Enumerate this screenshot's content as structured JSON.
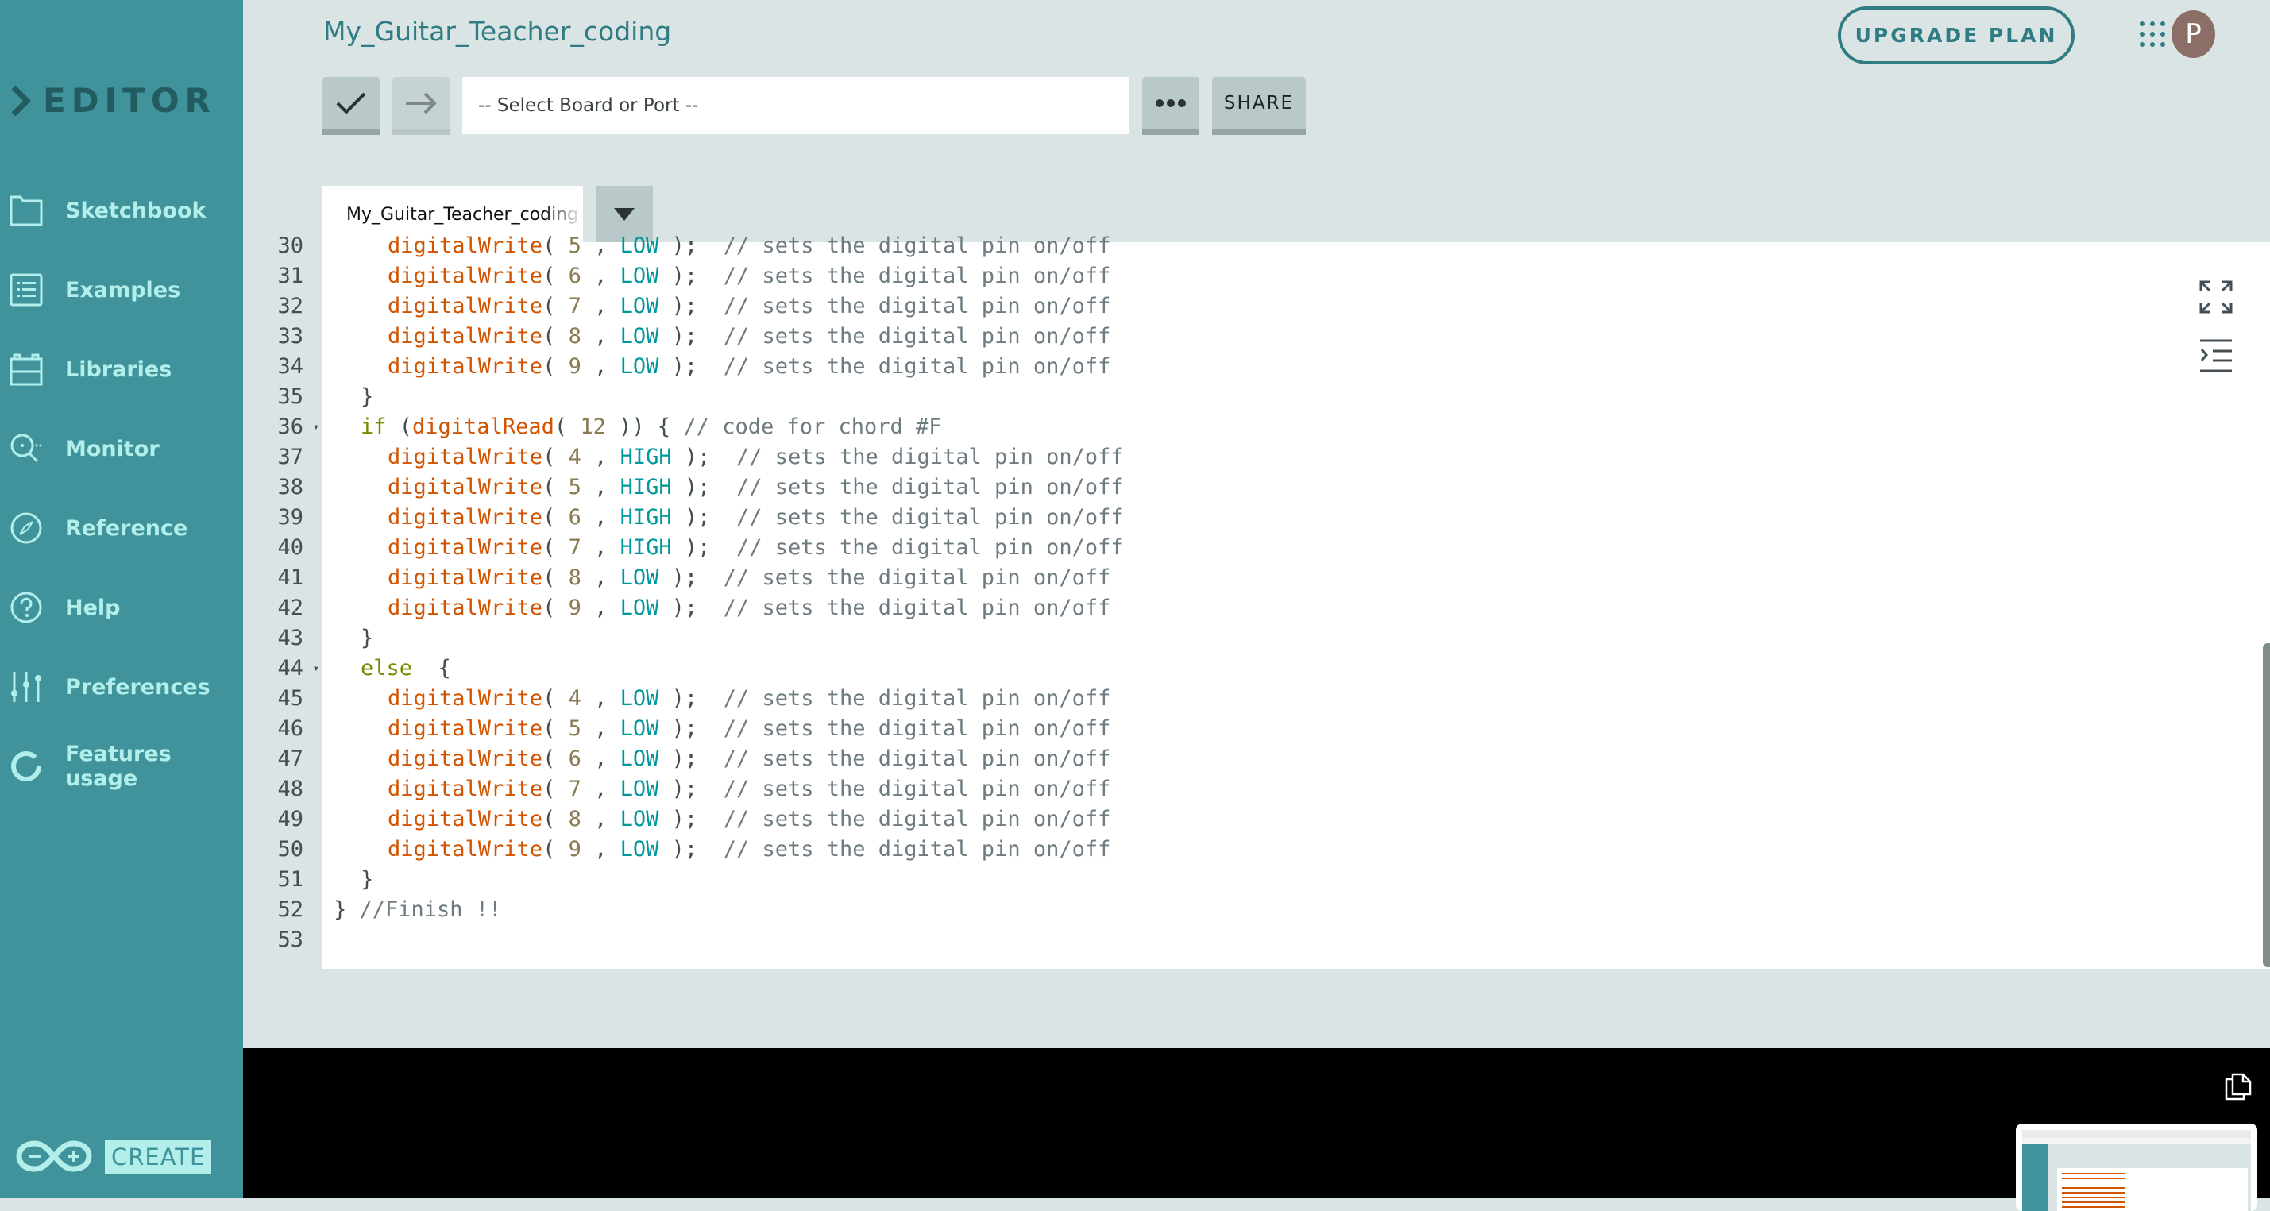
{
  "app": {
    "section_title": "EDITOR",
    "logo_badge": "CREATE"
  },
  "sidebar": {
    "items": [
      {
        "label": "Sketchbook",
        "icon": "folder-icon"
      },
      {
        "label": "Examples",
        "icon": "list-icon"
      },
      {
        "label": "Libraries",
        "icon": "library-icon"
      },
      {
        "label": "Monitor",
        "icon": "monitor-icon"
      },
      {
        "label": "Reference",
        "icon": "compass-icon"
      },
      {
        "label": "Help",
        "icon": "help-icon"
      },
      {
        "label": "Preferences",
        "icon": "sliders-icon"
      },
      {
        "label": "Features usage",
        "icon": "usage-ring-icon"
      }
    ]
  },
  "header": {
    "sketch_title": "My_Guitar_Teacher_coding",
    "upgrade_label": "UPGRADE PLAN",
    "avatar_initial": "P"
  },
  "toolbar": {
    "verify_icon": "checkmark-icon",
    "upload_icon": "arrow-right-icon",
    "board_placeholder": "-- Select Board or Port --",
    "more_icon": "ellipsis-icon",
    "share_label": "SHARE"
  },
  "tabs": {
    "active_file": "My_Guitar_Teacher_coding"
  },
  "editor": {
    "lines": [
      {
        "n": "30",
        "indent": 2,
        "tokens": [
          [
            "fn",
            "digitalWrite"
          ],
          [
            "p",
            "( "
          ],
          [
            "num",
            "5"
          ],
          [
            "p",
            " , "
          ],
          [
            "const",
            "LOW"
          ],
          [
            "p",
            " );  "
          ],
          [
            "cm",
            "// sets the digital pin on/off"
          ]
        ]
      },
      {
        "n": "31",
        "indent": 2,
        "tokens": [
          [
            "fn",
            "digitalWrite"
          ],
          [
            "p",
            "( "
          ],
          [
            "num",
            "6"
          ],
          [
            "p",
            " , "
          ],
          [
            "const",
            "LOW"
          ],
          [
            "p",
            " );  "
          ],
          [
            "cm",
            "// sets the digital pin on/off"
          ]
        ]
      },
      {
        "n": "32",
        "indent": 2,
        "tokens": [
          [
            "fn",
            "digitalWrite"
          ],
          [
            "p",
            "( "
          ],
          [
            "num",
            "7"
          ],
          [
            "p",
            " , "
          ],
          [
            "const",
            "LOW"
          ],
          [
            "p",
            " );  "
          ],
          [
            "cm",
            "// sets the digital pin on/off"
          ]
        ]
      },
      {
        "n": "33",
        "indent": 2,
        "tokens": [
          [
            "fn",
            "digitalWrite"
          ],
          [
            "p",
            "( "
          ],
          [
            "num",
            "8"
          ],
          [
            "p",
            " , "
          ],
          [
            "const",
            "LOW"
          ],
          [
            "p",
            " );  "
          ],
          [
            "cm",
            "// sets the digital pin on/off"
          ]
        ]
      },
      {
        "n": "34",
        "indent": 2,
        "tokens": [
          [
            "fn",
            "digitalWrite"
          ],
          [
            "p",
            "( "
          ],
          [
            "num",
            "9"
          ],
          [
            "p",
            " , "
          ],
          [
            "const",
            "LOW"
          ],
          [
            "p",
            " );  "
          ],
          [
            "cm",
            "// sets the digital pin on/off"
          ]
        ]
      },
      {
        "n": "35",
        "indent": 1,
        "tokens": [
          [
            "p",
            "}"
          ]
        ]
      },
      {
        "n": "36",
        "indent": 1,
        "fold": true,
        "tokens": [
          [
            "kw",
            "if"
          ],
          [
            "p",
            " ("
          ],
          [
            "fn",
            "digitalRead"
          ],
          [
            "p",
            "( "
          ],
          [
            "num",
            "12"
          ],
          [
            "p",
            " )) { "
          ],
          [
            "cm",
            "// code for chord #F"
          ]
        ]
      },
      {
        "n": "37",
        "indent": 2,
        "tokens": [
          [
            "fn",
            "digitalWrite"
          ],
          [
            "p",
            "( "
          ],
          [
            "num",
            "4"
          ],
          [
            "p",
            " , "
          ],
          [
            "const",
            "HIGH"
          ],
          [
            "p",
            " );  "
          ],
          [
            "cm",
            "// sets the digital pin on/off"
          ]
        ]
      },
      {
        "n": "38",
        "indent": 2,
        "tokens": [
          [
            "fn",
            "digitalWrite"
          ],
          [
            "p",
            "( "
          ],
          [
            "num",
            "5"
          ],
          [
            "p",
            " , "
          ],
          [
            "const",
            "HIGH"
          ],
          [
            "p",
            " );  "
          ],
          [
            "cm",
            "// sets the digital pin on/off"
          ]
        ]
      },
      {
        "n": "39",
        "indent": 2,
        "tokens": [
          [
            "fn",
            "digitalWrite"
          ],
          [
            "p",
            "( "
          ],
          [
            "num",
            "6"
          ],
          [
            "p",
            " , "
          ],
          [
            "const",
            "HIGH"
          ],
          [
            "p",
            " );  "
          ],
          [
            "cm",
            "// sets the digital pin on/off"
          ]
        ]
      },
      {
        "n": "40",
        "indent": 2,
        "tokens": [
          [
            "fn",
            "digitalWrite"
          ],
          [
            "p",
            "( "
          ],
          [
            "num",
            "7"
          ],
          [
            "p",
            " , "
          ],
          [
            "const",
            "HIGH"
          ],
          [
            "p",
            " );  "
          ],
          [
            "cm",
            "// sets the digital pin on/off"
          ]
        ]
      },
      {
        "n": "41",
        "indent": 2,
        "tokens": [
          [
            "fn",
            "digitalWrite"
          ],
          [
            "p",
            "( "
          ],
          [
            "num",
            "8"
          ],
          [
            "p",
            " , "
          ],
          [
            "const",
            "LOW"
          ],
          [
            "p",
            " );  "
          ],
          [
            "cm",
            "// sets the digital pin on/off"
          ]
        ]
      },
      {
        "n": "42",
        "indent": 2,
        "tokens": [
          [
            "fn",
            "digitalWrite"
          ],
          [
            "p",
            "( "
          ],
          [
            "num",
            "9"
          ],
          [
            "p",
            " , "
          ],
          [
            "const",
            "LOW"
          ],
          [
            "p",
            " );  "
          ],
          [
            "cm",
            "// sets the digital pin on/off"
          ]
        ]
      },
      {
        "n": "43",
        "indent": 1,
        "tokens": [
          [
            "p",
            "}"
          ]
        ]
      },
      {
        "n": "44",
        "indent": 1,
        "fold": true,
        "tokens": [
          [
            "kw",
            "else"
          ],
          [
            "p",
            "  {"
          ]
        ]
      },
      {
        "n": "45",
        "indent": 2,
        "tokens": [
          [
            "fn",
            "digitalWrite"
          ],
          [
            "p",
            "( "
          ],
          [
            "num",
            "4"
          ],
          [
            "p",
            " , "
          ],
          [
            "const",
            "LOW"
          ],
          [
            "p",
            " );  "
          ],
          [
            "cm",
            "// sets the digital pin on/off"
          ]
        ]
      },
      {
        "n": "46",
        "indent": 2,
        "tokens": [
          [
            "fn",
            "digitalWrite"
          ],
          [
            "p",
            "( "
          ],
          [
            "num",
            "5"
          ],
          [
            "p",
            " , "
          ],
          [
            "const",
            "LOW"
          ],
          [
            "p",
            " );  "
          ],
          [
            "cm",
            "// sets the digital pin on/off"
          ]
        ]
      },
      {
        "n": "47",
        "indent": 2,
        "tokens": [
          [
            "fn",
            "digitalWrite"
          ],
          [
            "p",
            "( "
          ],
          [
            "num",
            "6"
          ],
          [
            "p",
            " , "
          ],
          [
            "const",
            "LOW"
          ],
          [
            "p",
            " );  "
          ],
          [
            "cm",
            "// sets the digital pin on/off"
          ]
        ]
      },
      {
        "n": "48",
        "indent": 2,
        "tokens": [
          [
            "fn",
            "digitalWrite"
          ],
          [
            "p",
            "( "
          ],
          [
            "num",
            "7"
          ],
          [
            "p",
            " , "
          ],
          [
            "const",
            "LOW"
          ],
          [
            "p",
            " );  "
          ],
          [
            "cm",
            "// sets the digital pin on/off"
          ]
        ]
      },
      {
        "n": "49",
        "indent": 2,
        "tokens": [
          [
            "fn",
            "digitalWrite"
          ],
          [
            "p",
            "( "
          ],
          [
            "num",
            "8"
          ],
          [
            "p",
            " , "
          ],
          [
            "const",
            "LOW"
          ],
          [
            "p",
            " );  "
          ],
          [
            "cm",
            "// sets the digital pin on/off"
          ]
        ]
      },
      {
        "n": "50",
        "indent": 2,
        "tokens": [
          [
            "fn",
            "digitalWrite"
          ],
          [
            "p",
            "( "
          ],
          [
            "num",
            "9"
          ],
          [
            "p",
            " , "
          ],
          [
            "const",
            "LOW"
          ],
          [
            "p",
            " );  "
          ],
          [
            "cm",
            "// sets the digital pin on/off"
          ]
        ]
      },
      {
        "n": "51",
        "indent": 1,
        "tokens": [
          [
            "p",
            "}"
          ]
        ]
      },
      {
        "n": "52",
        "indent": 0,
        "tokens": [
          [
            "p",
            "} "
          ],
          [
            "cm",
            "//Finish !!"
          ]
        ]
      },
      {
        "n": "53",
        "indent": 0,
        "tokens": []
      }
    ],
    "tools": [
      "fullscreen-icon",
      "indent-icon"
    ]
  },
  "console": {
    "copy_icon": "copy-icon"
  },
  "colors": {
    "sidebar": "#40939a",
    "sidebar_text": "#b2efeb",
    "brand_text": "#225b60",
    "accent": "#2f7d83",
    "background": "#dbe4e4",
    "avatar": "#8b6e66",
    "keyword": "#728e00",
    "function": "#d35400",
    "number": "#8a7b52",
    "constant": "#00979c",
    "comment": "#6e7b81"
  }
}
